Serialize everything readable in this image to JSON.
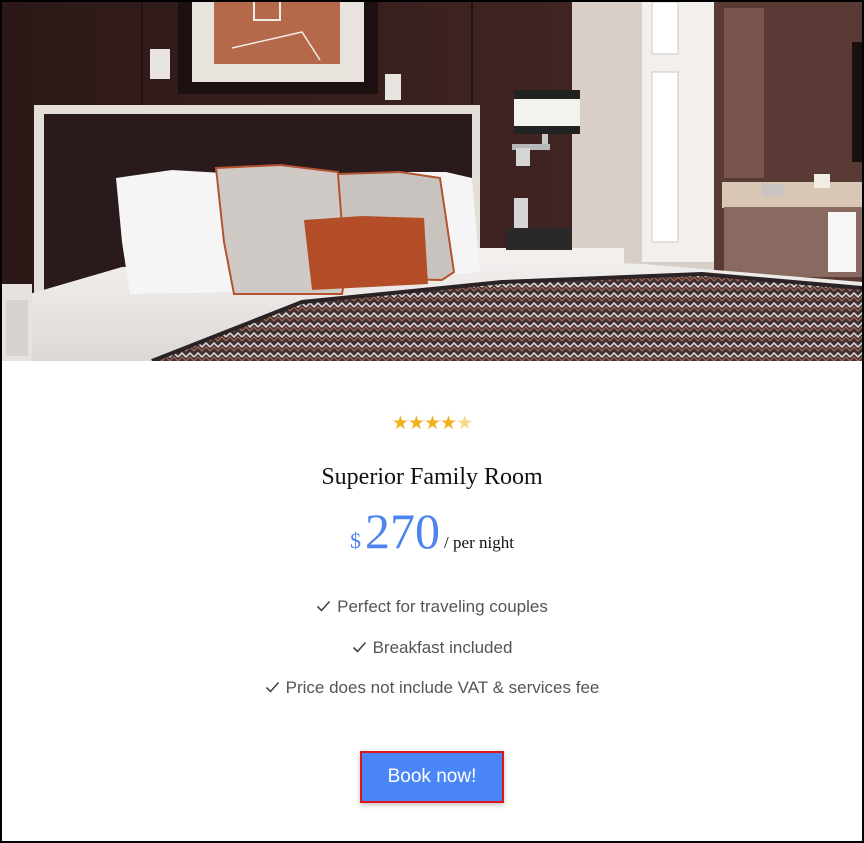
{
  "room": {
    "rating": 4,
    "rating_max": 5,
    "title": "Superior Family Room",
    "currency": "$",
    "price": "270",
    "price_unit": "/ per night",
    "features": [
      "Perfect for traveling couples",
      "Breakfast included",
      "Price does not include VAT & services fee"
    ],
    "book_label": "Book now!"
  },
  "colors": {
    "accent": "#4a86f7",
    "price": "#4c85ee",
    "star_full": "#f2b01e",
    "star_empty": "#f7d98a",
    "focus_outline": "#e0161c"
  },
  "icons": {
    "rating": "star-icon",
    "feature": "check-icon"
  }
}
